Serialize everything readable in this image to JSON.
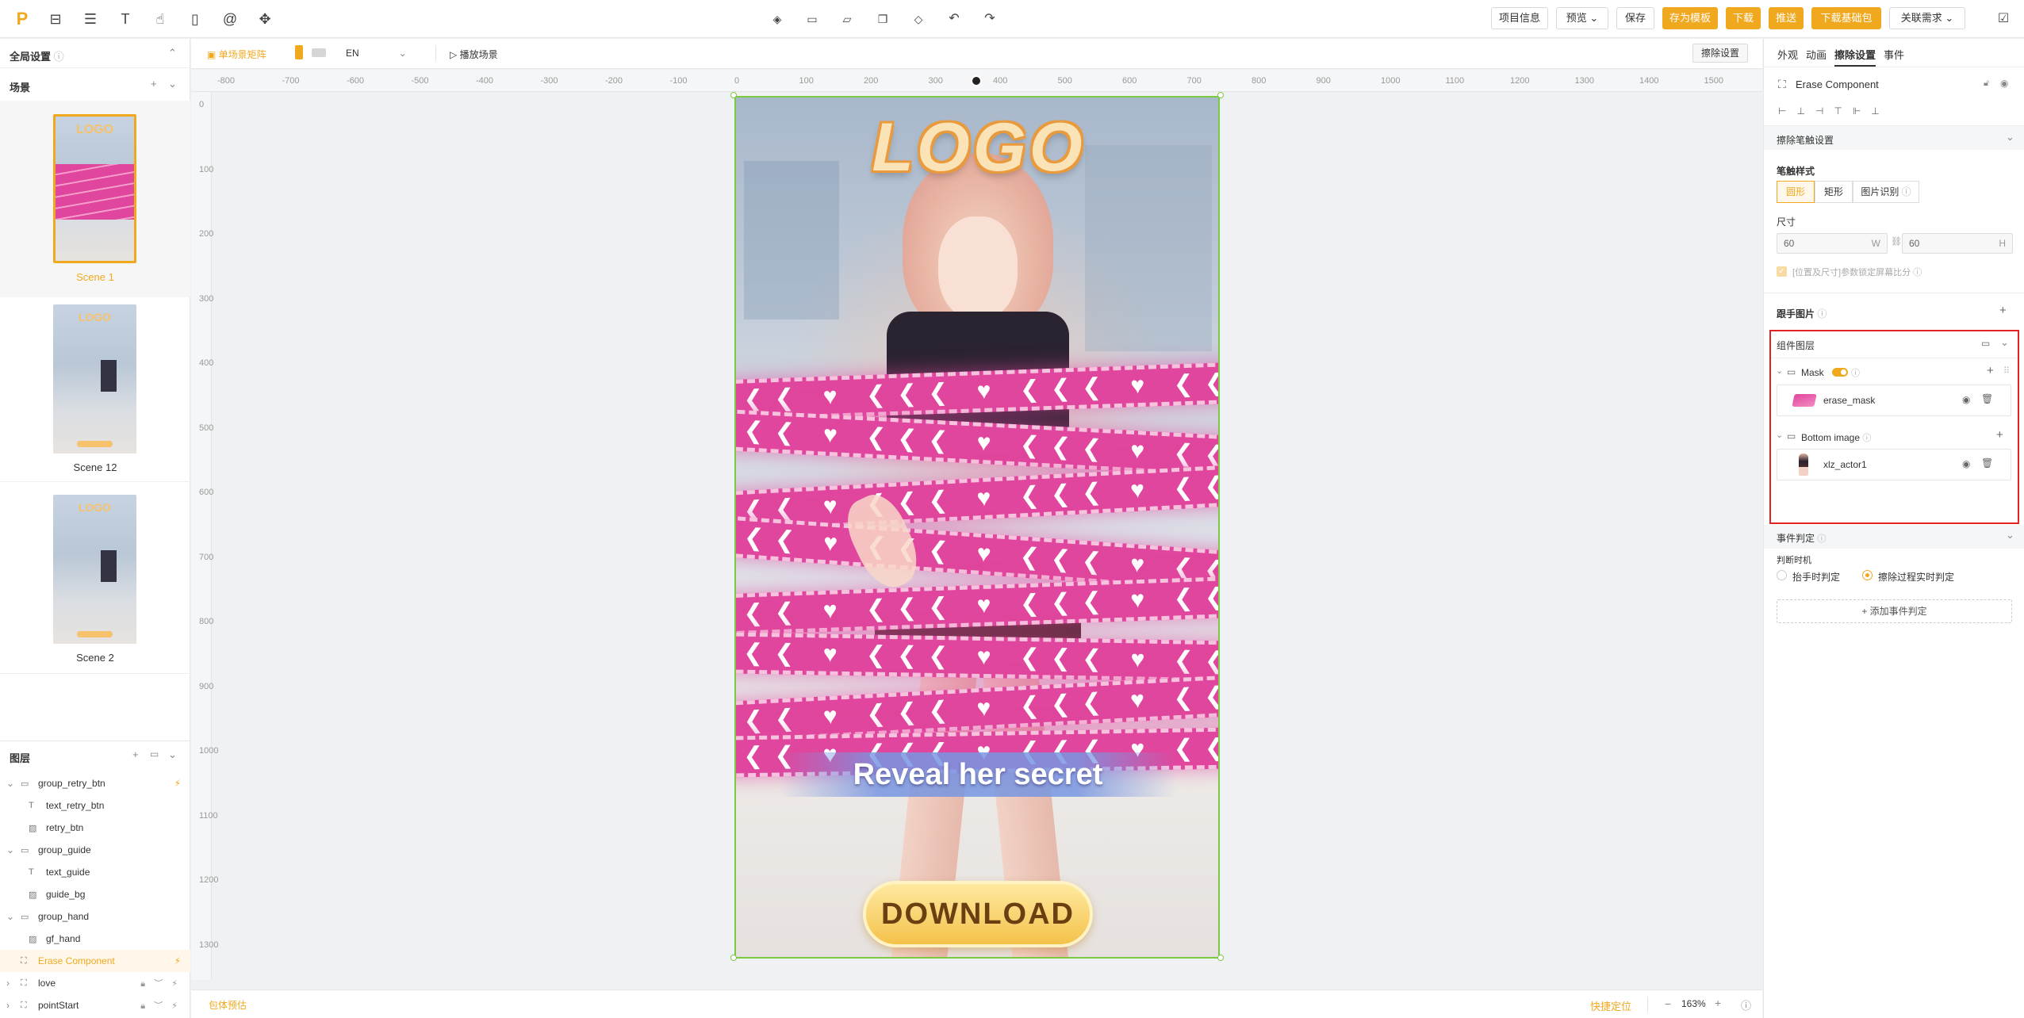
{
  "topbar": {
    "logo": "P",
    "icons": [
      "inbox-icon",
      "stack-icon",
      "text-icon",
      "hand-icon",
      "page-icon",
      "at-icon",
      "puzzle-icon"
    ],
    "center_icons": [
      "layers-icon",
      "folder-icon",
      "folder-open-icon",
      "copy-icon",
      "diamond-icon",
      "undo-icon",
      "redo-icon"
    ],
    "buttons": {
      "project_info": "项目信息",
      "preview": "预览",
      "save": "保存",
      "save_template": "存为模板",
      "download": "下载",
      "push": "推送",
      "download_base": "下载基础包",
      "related_demand": "关联需求"
    }
  },
  "left": {
    "global_settings": "全局设置",
    "scenes_title": "场景",
    "scenes": [
      {
        "label": "Scene 1"
      },
      {
        "label": "Scene 12"
      },
      {
        "label": "Scene 2"
      }
    ],
    "layers_title": "图层",
    "layers": [
      {
        "name": "group_retry_btn",
        "type": "group",
        "indent": 0
      },
      {
        "name": "text_retry_btn",
        "type": "text",
        "indent": 1
      },
      {
        "name": "retry_btn",
        "type": "image",
        "indent": 1
      },
      {
        "name": "group_guide",
        "type": "group",
        "indent": 0
      },
      {
        "name": "text_guide",
        "type": "text",
        "indent": 1
      },
      {
        "name": "guide_bg",
        "type": "image",
        "indent": 1
      },
      {
        "name": "group_hand",
        "type": "group",
        "indent": 0
      },
      {
        "name": "gf_hand",
        "type": "image",
        "indent": 1
      },
      {
        "name": "Erase Component",
        "type": "component",
        "indent": 0
      },
      {
        "name": "love",
        "type": "component",
        "indent": 0
      },
      {
        "name": "pointStart",
        "type": "component",
        "indent": 0
      }
    ]
  },
  "canvas_toolbar": {
    "single_scene_matrix": "单场景矩阵",
    "language": "EN",
    "play_scene": "播放场景",
    "erase_settings_btn": "擦除设置"
  },
  "ruler_x": [
    "-800",
    "-700",
    "-600",
    "-500",
    "-400",
    "-300",
    "-200",
    "-100",
    "0",
    "100",
    "200",
    "300",
    "400",
    "500",
    "600",
    "700",
    "800",
    "900",
    "1000",
    "1100",
    "1200",
    "1300",
    "1400",
    "1500"
  ],
  "ruler_y": [
    "0",
    "100",
    "200",
    "300",
    "400",
    "500",
    "600",
    "700",
    "800",
    "900",
    "1000",
    "1100",
    "1200",
    "1300"
  ],
  "stage": {
    "logo_text": "LOGO",
    "banner_text": "Reveal her secret",
    "download_text": "DOWNLOAD",
    "band_text": "❮❮❮ ♥ ❮❮❮ ♥ ❮❮❮ ♥ ❮❮❮ ♥ ❮❮❮ ♥"
  },
  "canvas_bottom": {
    "bundle_estimate": "包体预估",
    "quick_locate": "快捷定位",
    "zoom": "163%"
  },
  "right": {
    "tabs": [
      "外观",
      "动画",
      "擦除设置",
      "事件"
    ],
    "active_tab": "擦除设置",
    "component_name": "Erase Component",
    "brush_section": "擦除笔触设置",
    "brush_style_label": "笔触样式",
    "brush_styles": [
      "圆形",
      "矩形",
      "图片识别"
    ],
    "size_label": "尺寸",
    "size_w": "60",
    "size_h": "60",
    "w_unit": "W",
    "h_unit": "H",
    "checkbox_label": "[位置及尺寸]参数锁定屏幕比分",
    "hand_image_label": "跟手图片",
    "component_layers_label": "组件图层",
    "mask_label": "Mask",
    "mask_item": "erase_mask",
    "bottom_image_label": "Bottom image",
    "bottom_item": "xlz_actor1",
    "event_section": "事件判定",
    "judge_timing": "判断时机",
    "radio_options": [
      "抬手时判定",
      "擦除过程实时判定"
    ],
    "add_event": "添加事件判定"
  },
  "colors": {
    "accent": "#f0a91f",
    "highlight_box": "#e02424",
    "selection": "#7ac943",
    "band": "#e0469d"
  }
}
